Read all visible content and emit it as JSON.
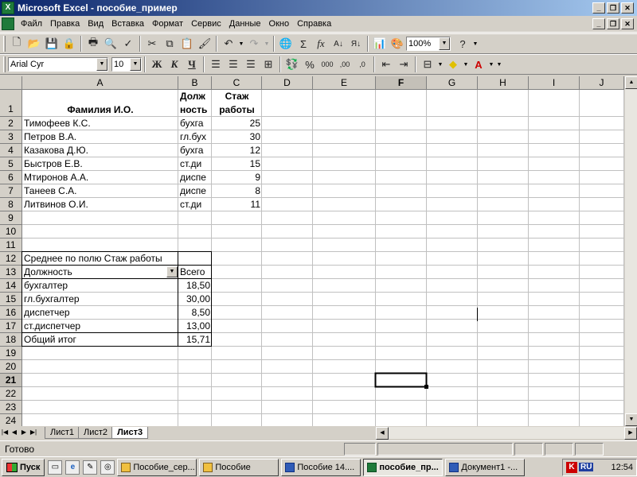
{
  "window": {
    "title": "Microsoft Excel - пособие_пример"
  },
  "menu": [
    "Файл",
    "Правка",
    "Вид",
    "Вставка",
    "Формат",
    "Сервис",
    "Данные",
    "Окно",
    "Справка"
  ],
  "toolbar": {
    "zoom": "100%",
    "font_name": "Arial Cyr",
    "font_size": "10"
  },
  "columns": [
    "A",
    "B",
    "C",
    "D",
    "E",
    "F",
    "G",
    "H",
    "I",
    "J"
  ],
  "rows": [
    "1",
    "2",
    "3",
    "4",
    "5",
    "6",
    "7",
    "8",
    "9",
    "10",
    "11",
    "12",
    "13",
    "14",
    "15",
    "16",
    "17",
    "18",
    "19",
    "20",
    "21",
    "22",
    "23",
    "24"
  ],
  "selected": {
    "column": "F",
    "row": "21"
  },
  "header": {
    "a": "Фамилия И.О.",
    "b1": "Долж",
    "b2": "ность",
    "c1": "Стаж",
    "c2": "работы"
  },
  "employees": [
    {
      "name": "Тимофеев К.С.",
      "pos": "бухга",
      "exp": "25"
    },
    {
      "name": "Петров В.А.",
      "pos": "гл.бух",
      "exp": "30"
    },
    {
      "name": "Казакова Д.Ю.",
      "pos": "бухга",
      "exp": "12"
    },
    {
      "name": "Быстров Е.В.",
      "pos": "ст.ди",
      "exp": "15"
    },
    {
      "name": "Мтиронов А.А.",
      "pos": "диспе",
      "exp": "9"
    },
    {
      "name": "Танеев С.А.",
      "pos": "диспе",
      "exp": "8"
    },
    {
      "name": "Литвинов  О.И.",
      "pos": "ст.ди",
      "exp": "11"
    }
  ],
  "pivot": {
    "title": "Среднее по полю Стаж работы",
    "row_field": "Должность",
    "total_header": "Всего",
    "rows": [
      {
        "label": "бухгалтер",
        "value": "18,50"
      },
      {
        "label": "гл.бухгалтер",
        "value": "30,00"
      },
      {
        "label": "диспетчер",
        "value": "8,50"
      },
      {
        "label": "ст.диспетчер",
        "value": "13,00"
      }
    ],
    "grand_total_label": "Общий итог",
    "grand_total_value": "15,71"
  },
  "sheets": [
    {
      "name": "Лист1",
      "active": false
    },
    {
      "name": "Лист2",
      "active": false
    },
    {
      "name": "Лист3",
      "active": true
    }
  ],
  "status": {
    "text": "Готово"
  },
  "taskbar": {
    "start": "Пуск",
    "tasks": [
      {
        "label": "Пособие_сер...",
        "kind": "folder",
        "active": false
      },
      {
        "label": "Пособие",
        "kind": "folder",
        "active": false
      },
      {
        "label": "Пособие 14....",
        "kind": "word",
        "active": false
      },
      {
        "label": "пособие_пр...",
        "kind": "xl",
        "active": true
      },
      {
        "label": "Документ1 -...",
        "kind": "word",
        "active": false
      }
    ],
    "lang": "RU",
    "clock": "12:54"
  }
}
